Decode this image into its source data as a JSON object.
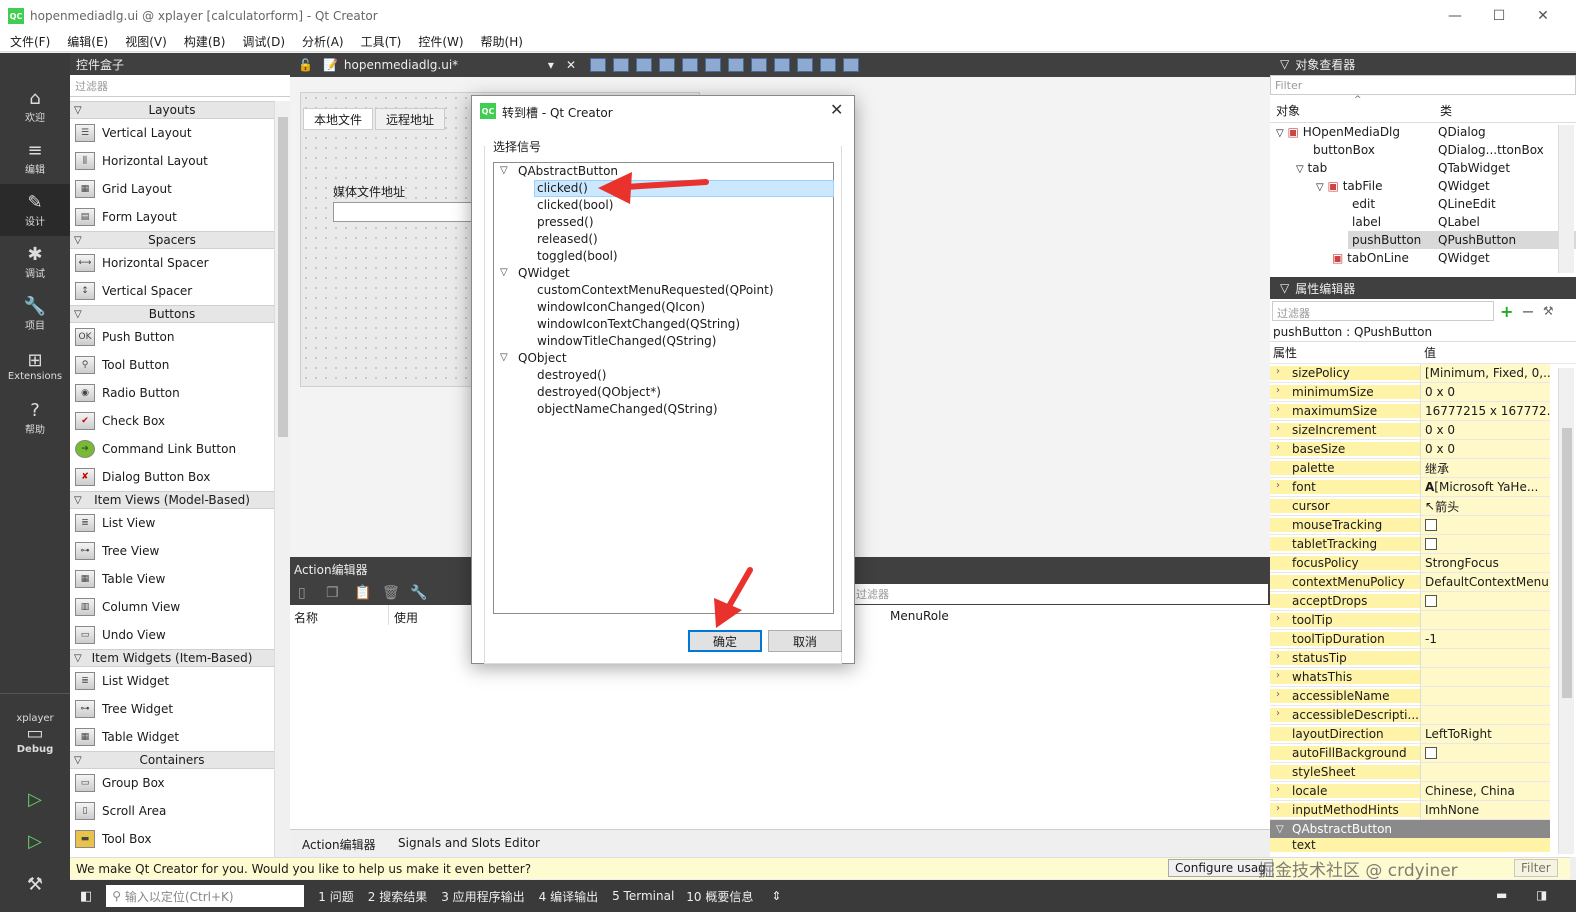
{
  "window": {
    "title": "hopenmediadlg.ui @ xplayer [calculatorform] - Qt Creator",
    "logo": "QC",
    "min": "—",
    "max": "☐",
    "close": "✕"
  },
  "menu": [
    "文件(F)",
    "编辑(E)",
    "视图(V)",
    "构建(B)",
    "调试(D)",
    "分析(A)",
    "工具(T)",
    "控件(W)",
    "帮助(H)"
  ],
  "modes": [
    {
      "icon": "⌂",
      "label": "欢迎"
    },
    {
      "icon": "≡",
      "label": "编辑"
    },
    {
      "icon": "✎",
      "label": "设计"
    },
    {
      "icon": "✱",
      "label": "调试"
    },
    {
      "icon": "🔧",
      "label": "项目"
    },
    {
      "icon": "⊞",
      "label": "Extensions"
    },
    {
      "icon": "?",
      "label": "帮助"
    }
  ],
  "kit": {
    "project": "xplayer",
    "config": "Debug"
  },
  "widgetbox": {
    "title": "控件盒子",
    "filter": "过滤器",
    "cats": {
      "layouts": "Layouts",
      "spacers": "Spacers",
      "buttons": "Buttons",
      "itemviews": "Item Views (Model-Based)",
      "itemwidgets": "Item Widgets (Item-Based)",
      "containers": "Containers"
    },
    "layouts": [
      "Vertical Layout",
      "Horizontal Layout",
      "Grid Layout",
      "Form Layout"
    ],
    "spacers": [
      "Horizontal Spacer",
      "Vertical Spacer"
    ],
    "buttons": [
      "Push Button",
      "Tool Button",
      "Radio Button",
      "Check Box",
      "Command Link Button",
      "Dialog Button Box"
    ],
    "itemviews": [
      "List View",
      "Tree View",
      "Table View",
      "Column View",
      "Undo View"
    ],
    "itemwidgets": [
      "List Widget",
      "Tree Widget",
      "Table Widget"
    ],
    "containers": [
      "Group Box",
      "Scroll Area",
      "Tool Box"
    ]
  },
  "editor": {
    "file": "hopenmediadlg.ui*",
    "tab1": "本地文件",
    "tab2": "远程地址",
    "label": "媒体文件地址"
  },
  "action": {
    "title": "Action编辑器",
    "col_name": "名称",
    "col_use": "使用",
    "filter": "过滤器",
    "col_role": "MenuRole",
    "bottom_tab1": "Action编辑器",
    "bottom_tab2": "Signals and Slots Editor"
  },
  "dialog": {
    "logo": "QC",
    "title": "转到槽 - Qt Creator",
    "group": "选择信号",
    "ok": "确定",
    "cancel": "取消",
    "g1": "QAbstractButton",
    "g1s": [
      "clicked()",
      "clicked(bool)",
      "pressed()",
      "released()",
      "toggled(bool)"
    ],
    "g2": "QWidget",
    "g2s": [
      "customContextMenuRequested(QPoint)",
      "windowIconChanged(QIcon)",
      "windowIconTextChanged(QString)",
      "windowTitleChanged(QString)"
    ],
    "g3": "QObject",
    "g3s": [
      "destroyed()",
      "destroyed(QObject*)",
      "objectNameChanged(QString)"
    ]
  },
  "objinsp": {
    "title": "对象查看器",
    "filter": "Filter",
    "col1": "对象",
    "col2": "类",
    "rows": [
      {
        "n": "HOpenMediaDlg",
        "c": "QDialog"
      },
      {
        "n": "buttonBox",
        "c": "QDialog...ttonBox"
      },
      {
        "n": "tab",
        "c": "QTabWidget"
      },
      {
        "n": "tabFile",
        "c": "QWidget"
      },
      {
        "n": "edit",
        "c": "QLineEdit"
      },
      {
        "n": "label",
        "c": "QLabel"
      },
      {
        "n": "pushButton",
        "c": "QPushButton"
      },
      {
        "n": "tabOnLine",
        "c": "QWidget"
      }
    ]
  },
  "propedit": {
    "title": "属性编辑器",
    "filter": "过滤器",
    "obj": "pushButton : QPushButton",
    "col1": "属性",
    "col2": "值",
    "rows": [
      [
        "sizePolicy",
        "[Minimum, Fixed, 0,..."
      ],
      [
        "minimumSize",
        "0 x 0"
      ],
      [
        "maximumSize",
        "16777215 x 167772..."
      ],
      [
        "sizeIncrement",
        "0 x 0"
      ],
      [
        "baseSize",
        "0 x 0"
      ],
      [
        "palette",
        "继承"
      ],
      [
        "font",
        "[Microsoft YaHe..."
      ],
      [
        "cursor",
        "箭头"
      ],
      [
        "mouseTracking",
        ""
      ],
      [
        "tabletTracking",
        ""
      ],
      [
        "focusPolicy",
        "StrongFocus"
      ],
      [
        "contextMenuPolicy",
        "DefaultContextMenu"
      ],
      [
        "acceptDrops",
        ""
      ],
      [
        "toolTip",
        ""
      ],
      [
        "toolTipDuration",
        "-1"
      ],
      [
        "statusTip",
        ""
      ],
      [
        "whatsThis",
        ""
      ],
      [
        "accessibleName",
        ""
      ],
      [
        "accessibleDescripti...",
        ""
      ],
      [
        "layoutDirection",
        "LeftToRight"
      ],
      [
        "autoFillBackground",
        ""
      ],
      [
        "styleSheet",
        ""
      ],
      [
        "locale",
        "Chinese, China"
      ],
      [
        "inputMethodHints",
        "ImhNone"
      ]
    ],
    "section": "QAbstractButton",
    "next": "text"
  },
  "info": {
    "text": "We make Qt Creator for you. Would you like to help us make it even better?",
    "configure": "Configure usag",
    "watermark": "掘金技术社区 @ crdyiner",
    "filter_btn": "Filter"
  },
  "status": {
    "locate": "输入以定位(Ctrl+K)",
    "items": [
      "1 问题",
      "2 搜索结果",
      "3 应用程序输出",
      "4 编译输出",
      "5 Terminal",
      "10 概要信息"
    ]
  }
}
